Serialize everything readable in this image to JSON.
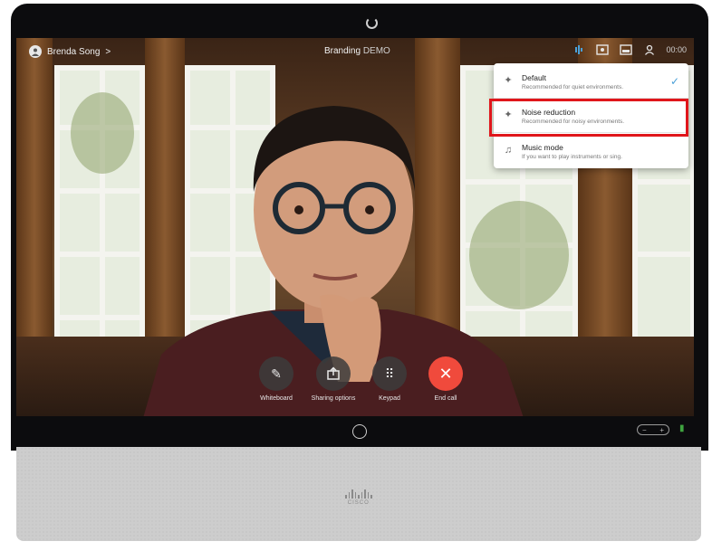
{
  "top_bar": {
    "caller_name": "Brenda Song",
    "caller_chevron": ">",
    "meeting_title": "Branding",
    "recording_label": "DEMO",
    "clock": "00:00"
  },
  "noise_menu": {
    "items": [
      {
        "title": "Default",
        "subtitle": "Recommended for quiet environments.",
        "icon": "mic-icon",
        "selected": true
      },
      {
        "title": "Noise reduction",
        "subtitle": "Recommended for noisy environments.",
        "icon": "mic-icon",
        "selected": false
      },
      {
        "title": "Music mode",
        "subtitle": "If you want to play instruments or sing.",
        "icon": "music-note-icon",
        "selected": false
      }
    ]
  },
  "call_controls": {
    "whiteboard": "Whiteboard",
    "sharing": "Sharing options",
    "keypad": "Keypad",
    "end_call": "End call"
  },
  "device": {
    "brand": "CISCO"
  },
  "colors": {
    "end_call": "#f04a3c",
    "highlight": "#e0161b",
    "check": "#4aa0d8"
  }
}
